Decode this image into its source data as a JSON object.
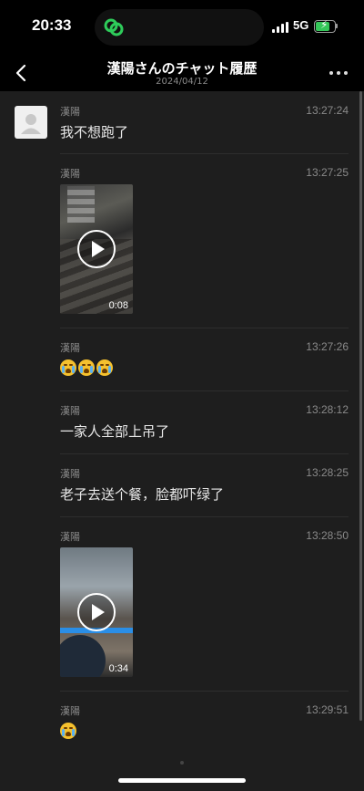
{
  "status": {
    "time": "20:33",
    "network": "5G"
  },
  "nav": {
    "title": "漢陽さんのチャット履歴",
    "date": "2024/04/12"
  },
  "messages": [
    {
      "sender": "漢陽",
      "time": "13:27:24",
      "text": "我不想跑了"
    },
    {
      "sender": "漢陽",
      "time": "13:27:25",
      "video_duration": "0:08"
    },
    {
      "sender": "漢陽",
      "time": "13:27:26",
      "emoji": "😭😭😭"
    },
    {
      "sender": "漢陽",
      "time": "13:28:12",
      "text": "一家人全部上吊了"
    },
    {
      "sender": "漢陽",
      "time": "13:28:25",
      "text": "老子去送个餐，脸都吓绿了"
    },
    {
      "sender": "漢陽",
      "time": "13:28:50",
      "video_duration": "0:34"
    },
    {
      "sender": "漢陽",
      "time": "13:29:51",
      "emoji": "😭"
    }
  ],
  "icons": {
    "back": "chevron-left-icon",
    "more": "more-dots-icon",
    "play": "play-icon",
    "island": "link-icon"
  },
  "colors": {
    "accent_green": "#35c759",
    "background": "#1e1e1e"
  }
}
